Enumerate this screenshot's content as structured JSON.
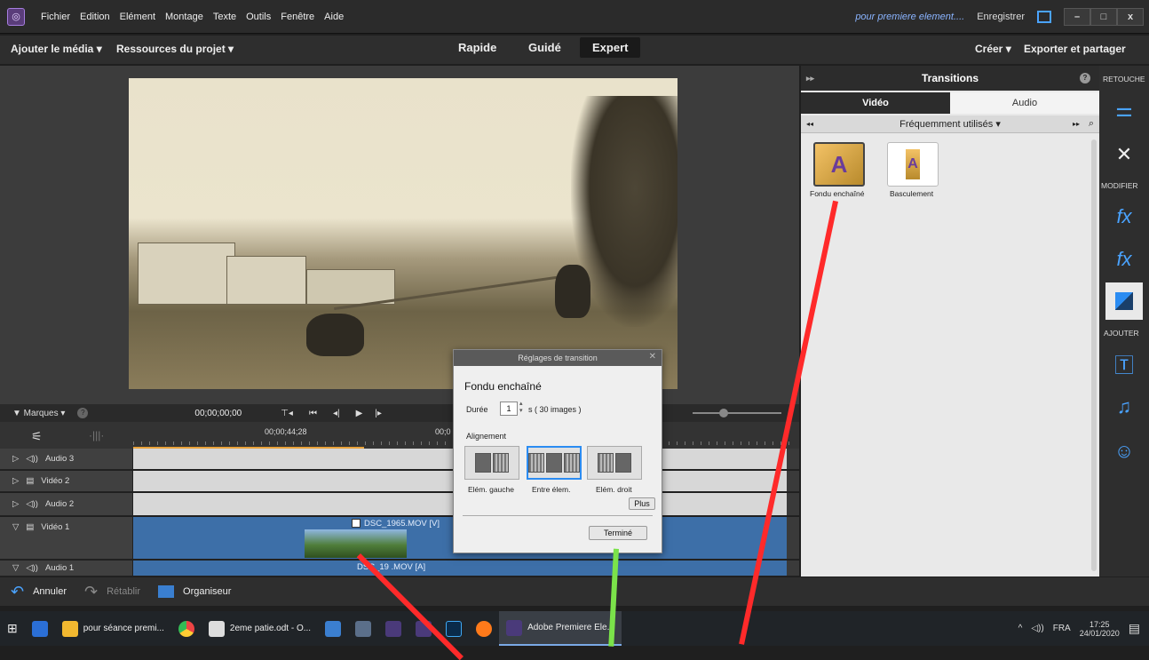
{
  "menubar": {
    "items": [
      "Fichier",
      "Edition",
      "Elément",
      "Montage",
      "Texte",
      "Outils",
      "Fenêtre",
      "Aide"
    ],
    "project": "pour premiere element....",
    "save_label": "Enregistrer"
  },
  "topbar": {
    "add_media": "Ajouter le média ▾",
    "project_res": "Ressources du projet ▾",
    "modes": [
      "Rapide",
      "Guidé",
      "Expert"
    ],
    "create": "Créer ▾",
    "export": "Exporter et partager"
  },
  "transport": {
    "marks": "▼ Marques ▾",
    "timecode": "00;00;00;00"
  },
  "ruler": {
    "tc1": "00;00;44;28",
    "tc2": "00;0"
  },
  "tracks": [
    {
      "name": "Audio 3"
    },
    {
      "name": "Vidéo 2"
    },
    {
      "name": "Audio 2"
    },
    {
      "name": "Vidéo 1"
    },
    {
      "name": "Audio 1"
    }
  ],
  "clips": {
    "video": "DSC_1965.MOV [V]",
    "audio": "DSC_19 .MOV [A]"
  },
  "dialog": {
    "title": "Réglages de transition",
    "name": "Fondu enchaîné",
    "duration_label": "Durée",
    "duration_value": "1",
    "duration_unit": "s  ( 30 images )",
    "alignment_label": "Alignement",
    "options": [
      "Elém. gauche",
      "Entre élem.",
      "Elém. droit"
    ],
    "more": "Plus",
    "done": "Terminé"
  },
  "panel": {
    "title": "Transitions",
    "tabs": [
      "Vidéo",
      "Audio"
    ],
    "filter": "Fréquemment utilisés ▾",
    "items": [
      "Fondu enchaîné",
      "Basculement"
    ]
  },
  "sidebar": {
    "retouche": "RETOUCHE",
    "modifier": "MODIFIER",
    "ajouter": "AJOUTER"
  },
  "bottombar": {
    "undo": "Annuler",
    "redo": "Rétablir",
    "organizer": "Organiseur"
  },
  "taskbar": {
    "items": [
      "pour séance premi...",
      "2eme patie.odt - O...",
      "Adobe Premiere Ele..."
    ],
    "lang": "FRA",
    "time": "17:25",
    "date": "24/01/2020"
  },
  "colors": {
    "accent": "#2b8cf2",
    "arrow_red": "#ff2a2a",
    "arrow_green": "#7be34a",
    "clip_blue": "#3d6fa8"
  }
}
